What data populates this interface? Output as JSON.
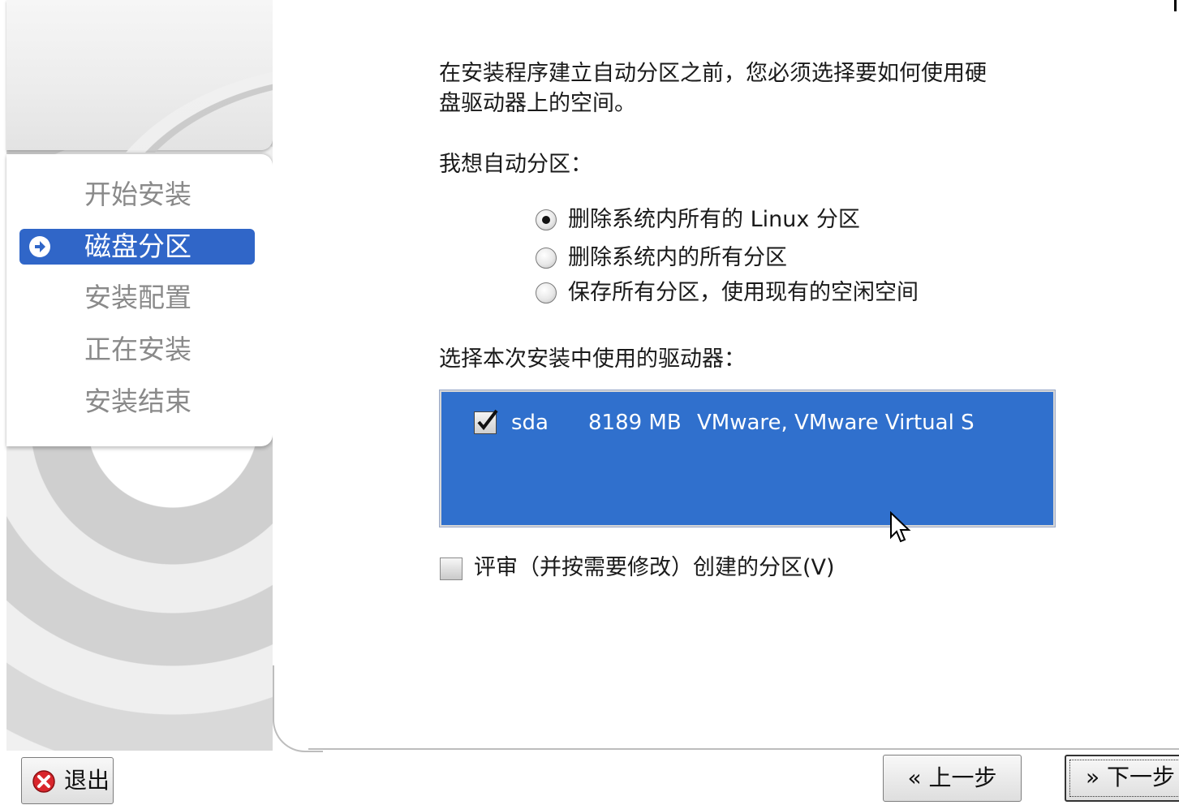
{
  "sidebar": {
    "steps": [
      {
        "label": "开始安装",
        "active": false
      },
      {
        "label": "磁盘分区",
        "active": true
      },
      {
        "label": "安装配置",
        "active": false
      },
      {
        "label": "正在安装",
        "active": false
      },
      {
        "label": "安装结束",
        "active": false
      }
    ],
    "accent_color": "#3066c8"
  },
  "main": {
    "intro_line1": "在安装程序建立自动分区之前，您必须选择要如何使用硬",
    "intro_line2": "盘驱动器上的空间。",
    "partition_label": "我想自动分区：",
    "partition_options": [
      {
        "label": "删除系统内所有的 Linux 分区",
        "selected": true
      },
      {
        "label": "删除系统内的所有分区",
        "selected": false
      },
      {
        "label": "保存所有分区，使用现有的空闲空间",
        "selected": false
      }
    ],
    "drive_label": "选择本次安装中使用的驱动器：",
    "drives": [
      {
        "checked": true,
        "name": "sda",
        "size": "8189 MB",
        "model": "VMware, VMware Virtual S"
      }
    ],
    "drive_list_color": "#3070cd",
    "review_label": "评审（并按需要修改）创建的分区(V)",
    "review_checked": false
  },
  "footer": {
    "exit_label": "退出",
    "back_label": "« 上一步",
    "next_label": "» 下一步"
  }
}
